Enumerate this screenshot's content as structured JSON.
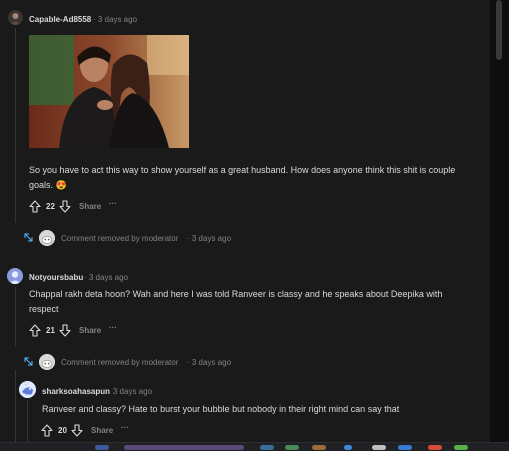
{
  "comments": [
    {
      "username": "Capable-Ad8558",
      "time": "· 3 days ago",
      "body": "So you have to act this way to show yourself as a great husband. How does anyone think this shit is couple goals. 😍",
      "votes": "22",
      "share": "Share",
      "more": "···"
    },
    {
      "removed": "Comment removed by moderator",
      "time": "· 3 days ago"
    },
    {
      "username": "Notyoursbabu",
      "time": "· 3 days ago",
      "body": "Chappal rakh deta hoon? Wah and here I was told Ranveer is classy and he speaks about Deepika with respect",
      "votes": "21",
      "share": "Share",
      "more": "···"
    },
    {
      "removed": "Comment removed by moderator",
      "time": "· 3 days ago"
    },
    {
      "username": "sharksoahasapun",
      "time": "· 3 days ago",
      "body": "Ranveer and classy? Hate to burst your bubble but nobody in their right mind can say that",
      "votes": "20",
      "share": "Share",
      "more": "···"
    }
  ],
  "colors": {
    "background": "#1a1a1b",
    "text": "#d7dadc",
    "muted": "#818384",
    "thread_line": "#343536"
  }
}
